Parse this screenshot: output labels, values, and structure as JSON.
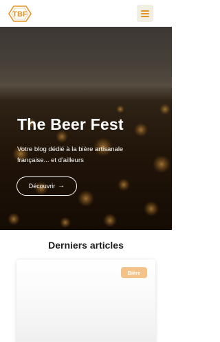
{
  "header": {
    "logo_text": "TBF",
    "menu_icon": "hamburger-menu-icon",
    "accent_color": "#e39324"
  },
  "hero": {
    "title": "The Beer Fest",
    "subtitle": "Votre blog dédié à la bière artisanale française... et d'ailleurs",
    "cta_label": "Découvrir",
    "cta_icon": "arrow-right-icon"
  },
  "articles": {
    "heading": "Derniers articles",
    "cards": [
      {
        "category": "Bière"
      }
    ]
  }
}
